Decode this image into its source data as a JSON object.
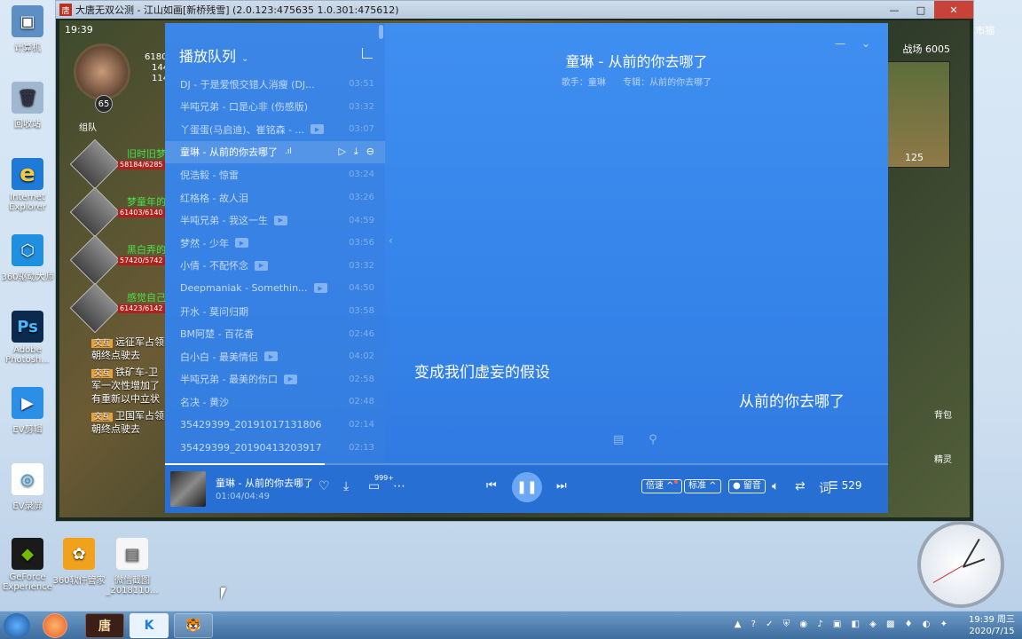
{
  "desktop": {
    "icons": [
      {
        "label": "计算机",
        "glyph": "▣"
      },
      {
        "label": "回收站",
        "glyph": "🗑"
      },
      {
        "label": "Internet Explorer",
        "glyph": "e"
      },
      {
        "label": "360驱动大师",
        "glyph": "⬡"
      },
      {
        "label": "Adobe Photosh...",
        "glyph": "Ps"
      },
      {
        "label": "EV剪辑",
        "glyph": "▶"
      },
      {
        "label": "EV录屏",
        "glyph": "◎"
      },
      {
        "label": "GeForce Experience",
        "glyph": "◆"
      },
      {
        "label": "360软件管家",
        "glyph": "✿"
      },
      {
        "label": "微信截图_2018110...",
        "glyph": "▤"
      }
    ],
    "cc_label": "CC市猫"
  },
  "game": {
    "title": "大唐无双公测 - 江山如画[新桥残雪] (2.0.123:475635 1.0.301:475612)",
    "logo": "唐",
    "controls": [
      "—",
      "□",
      "✕"
    ],
    "clock_text": "19:39",
    "level": "65",
    "hp_values": [
      "6180",
      "144",
      "114"
    ],
    "team_label": "组队",
    "party": [
      {
        "name": "旧时旧梦",
        "hp": "58184/6285"
      },
      {
        "name": "梦童年的",
        "hp": "61403/6140"
      },
      {
        "name": "黑白弄的",
        "hp": "57420/5742"
      },
      {
        "name": "感觉自己",
        "hp": "61423/6142"
      }
    ],
    "chat": [
      {
        "tag": "交互",
        "text": "远征军占领"
      },
      {
        "tag": "",
        "text": "朝终点驶去"
      },
      {
        "tag": "交互",
        "text": "铁矿车-卫"
      },
      {
        "tag": "",
        "text": "军一次性增加了"
      },
      {
        "tag": "",
        "text": "有重新以中立状"
      },
      {
        "tag": "交互",
        "text": "卫国军占领"
      },
      {
        "tag": "",
        "text": "朝终点驶去"
      }
    ],
    "map_label": "战场 6005",
    "map_num": "125",
    "right_labels": [
      "背包",
      "精灵"
    ]
  },
  "player": {
    "queue_title": "播放队列",
    "queue": [
      {
        "name": "DJ - 于是爱恨交错人消瘦 (DJ...",
        "dur": "03:51",
        "mv": false
      },
      {
        "name": "半吨兄弟 - 口是心非 (伤感版)",
        "dur": "03:32",
        "mv": false
      },
      {
        "name": "丫蛋蛋(马启迪)、崔铭森 - ...",
        "dur": "03:07",
        "mv": true
      },
      {
        "name": "童琳 - 从前的你去哪了",
        "dur": "",
        "mv": false,
        "active": true
      },
      {
        "name": "倪浩毅 - 惊雷",
        "dur": "03:24",
        "mv": false
      },
      {
        "name": "红格格 - 故人泪",
        "dur": "03:26",
        "mv": false
      },
      {
        "name": "半吨兄弟 - 我这一生",
        "dur": "04:59",
        "mv": true
      },
      {
        "name": "梦然 - 少年",
        "dur": "03:56",
        "mv": true
      },
      {
        "name": "小倩 - 不配怀念",
        "dur": "03:32",
        "mv": true
      },
      {
        "name": "Deepmaniak - Somethin...",
        "dur": "04:50",
        "mv": true
      },
      {
        "name": "开水 - 莫问归期",
        "dur": "03:58",
        "mv": false
      },
      {
        "name": "BM阿楚 - 百花香",
        "dur": "02:46",
        "mv": false
      },
      {
        "name": "白小白 - 最美情侣",
        "dur": "04:02",
        "mv": true
      },
      {
        "name": "半吨兄弟 - 最美的伤口",
        "dur": "02:58",
        "mv": true
      },
      {
        "name": "名决 - 黄沙",
        "dur": "02:48",
        "mv": false
      },
      {
        "name": "35429399_20191017131806",
        "dur": "02:14",
        "mv": false
      },
      {
        "name": "35429399_20190413203917",
        "dur": "02:13",
        "mv": false
      }
    ],
    "song_title": "童琳 - 从前的你去哪了",
    "singer": "歌手：童琳",
    "album": "专辑：从前的你去哪了",
    "lyric_line1": "变成我们虚妄的假设",
    "lyric_line2": "从前的你去哪了",
    "now_playing": "童琳 - 从前的你去哪了",
    "time": "01:04/04:49",
    "progress": 0.221,
    "comment_count": "999+",
    "speed_label": "倍速",
    "quality_label": "标准",
    "ambient_label": "留音",
    "lyric_toggle": "词",
    "queue_count": "529"
  },
  "taskbar": {
    "apps": [
      "唐",
      "K",
      "🐯"
    ],
    "time": "19:39 周三",
    "date": "2020/7/15"
  },
  "colors": {
    "player_bg": "#3584ea",
    "accent": "#6aa8f6",
    "party_name": "#48e04a"
  }
}
